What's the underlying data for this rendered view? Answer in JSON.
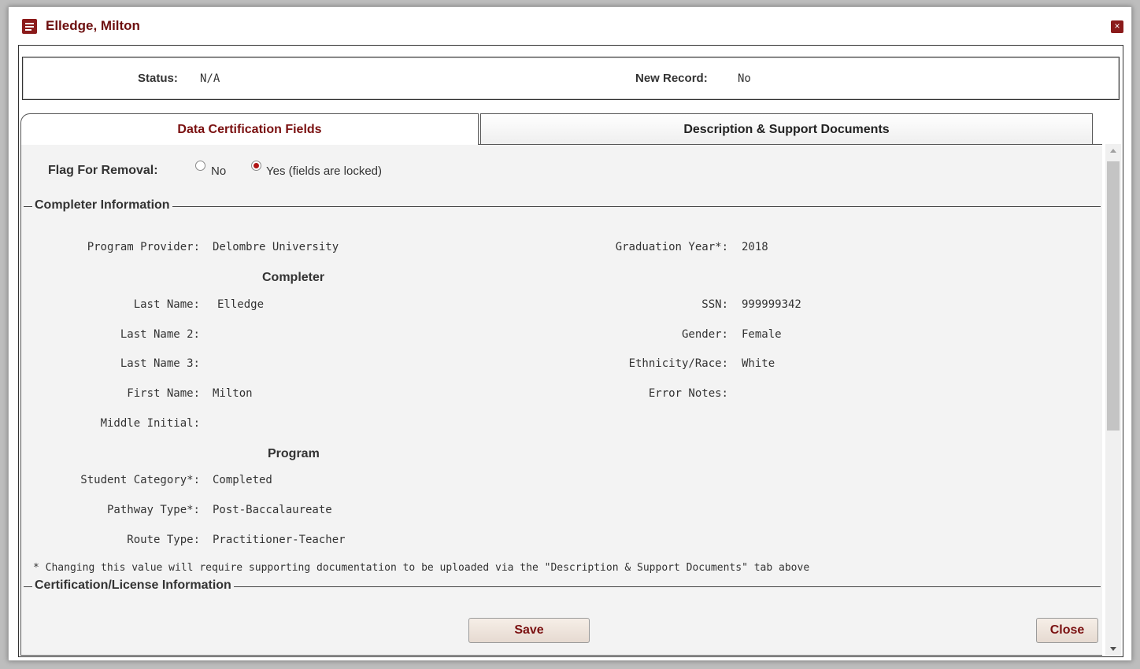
{
  "dialog": {
    "title": "Elledge, Milton",
    "close_glyph": "×",
    "title_icon": "document-list-icon",
    "accent_color": "#8b1a1a"
  },
  "header": {
    "status_label": "Status:",
    "status_value": "N/A",
    "new_record_label": "New Record:",
    "new_record_value": "No"
  },
  "tabs": [
    {
      "label": "Data Certification Fields",
      "active": true
    },
    {
      "label": "Description & Support Documents",
      "active": false
    }
  ],
  "flag": {
    "label": "Flag For Removal:",
    "options": [
      {
        "label": "No",
        "selected": false
      },
      {
        "label": "Yes (fields are locked)",
        "selected": true
      }
    ]
  },
  "completer_info": {
    "legend": "Completer Information",
    "program_provider_label": "Program Provider:",
    "program_provider_value": "Delombre University",
    "graduation_year_label": "Graduation Year*:",
    "graduation_year_value": "2018",
    "completer_heading": "Completer",
    "last_name_label": "Last Name:",
    "last_name_value": "Elledge",
    "last_name2_label": "Last Name 2:",
    "last_name2_value": "",
    "last_name3_label": "Last Name 3:",
    "last_name3_value": "",
    "first_name_label": "First Name:",
    "first_name_value": "Milton",
    "middle_initial_label": "Middle Initial:",
    "middle_initial_value": "",
    "ssn_label": "SSN:",
    "ssn_value": "999999342",
    "gender_label": "Gender:",
    "gender_value": "Female",
    "ethnicity_label": "Ethnicity/Race:",
    "ethnicity_value": "White",
    "error_notes_label": "Error Notes:",
    "error_notes_value": "",
    "program_heading": "Program",
    "student_category_label": "Student Category*:",
    "student_category_value": "Completed",
    "pathway_type_label": "Pathway Type*:",
    "pathway_type_value": "Post-Baccalaureate",
    "route_type_label": "Route Type:",
    "route_type_value": "Practitioner-Teacher",
    "note": "* Changing this value will require supporting documentation to be uploaded via the \"Description & Support Documents\" tab above"
  },
  "certification_info": {
    "legend": "Certification/License Information"
  },
  "buttons": {
    "save": "Save",
    "close": "Close"
  }
}
